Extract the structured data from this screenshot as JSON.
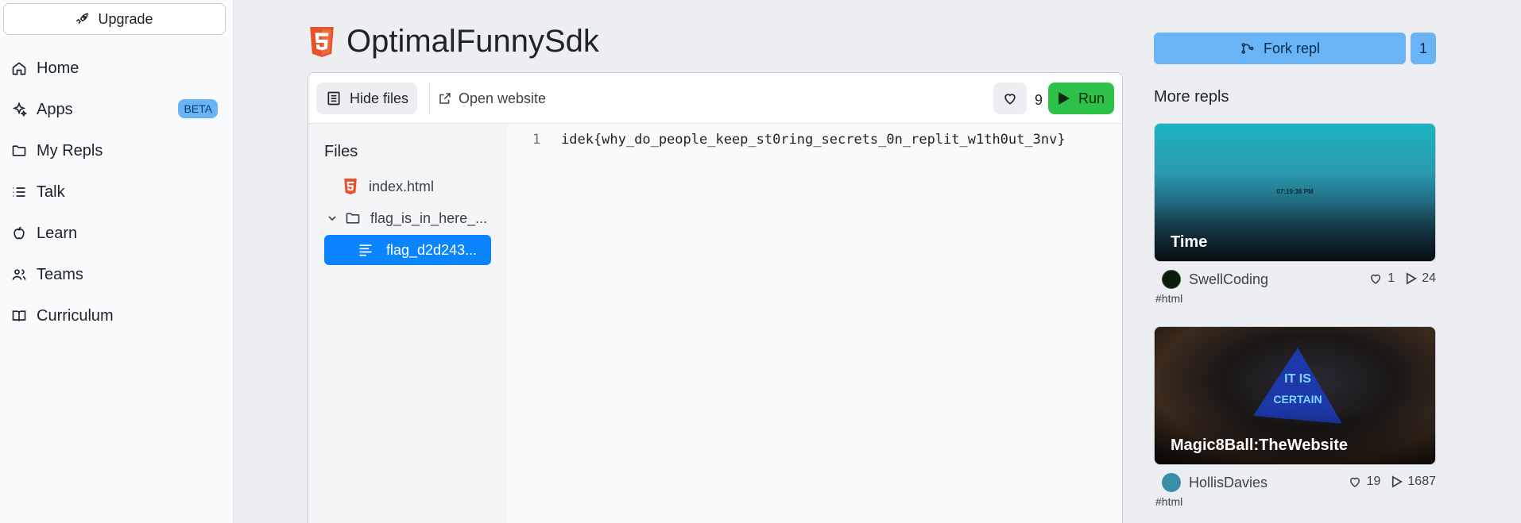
{
  "sidebar": {
    "upgrade_label": "Upgrade",
    "items": [
      {
        "label": "Home",
        "icon": "home-icon"
      },
      {
        "label": "Apps",
        "icon": "apps-icon",
        "badge": "BETA"
      },
      {
        "label": "My Repls",
        "icon": "folder-icon"
      },
      {
        "label": "Talk",
        "icon": "list-icon"
      },
      {
        "label": "Learn",
        "icon": "apple-icon"
      },
      {
        "label": "Teams",
        "icon": "users-icon"
      },
      {
        "label": "Curriculum",
        "icon": "book-icon"
      }
    ]
  },
  "repl": {
    "title": "OptimalFunnySdk",
    "icon": "html5-icon"
  },
  "toolbar": {
    "hide_files_label": "Hide files",
    "open_website_label": "Open website",
    "like_count": "9",
    "run_label": "Run"
  },
  "files": {
    "title": "Files",
    "items": [
      {
        "name": "index.html",
        "icon": "html5-icon"
      },
      {
        "name": "flag_is_in_here_...",
        "icon": "folder-icon",
        "expanded": true
      },
      {
        "name": "flag_d2d243...",
        "icon": "text-file-icon",
        "selected": true
      }
    ]
  },
  "editor": {
    "line_number": "1",
    "code": "idek{why_do_people_keep_st0ring_secrets_0n_replit_w1th0ut_3nv}"
  },
  "fork": {
    "label": "Fork repl",
    "count": "1"
  },
  "more_repls": {
    "title": "More repls",
    "cards": [
      {
        "title": "Time",
        "clock": "07:19:36 PM",
        "author": "SwellCoding",
        "likes": "1",
        "runs": "24",
        "tag": "#html"
      },
      {
        "title": "Magic8Ball:TheWebsite",
        "author": "HollisDavies",
        "likes": "19",
        "runs": "1687",
        "tag": "#html"
      }
    ]
  },
  "colors": {
    "accent_blue": "#69b4f7",
    "run_green": "#2ec14a",
    "selected_blue": "#0a84ff",
    "html5_orange": "#e4532a"
  }
}
